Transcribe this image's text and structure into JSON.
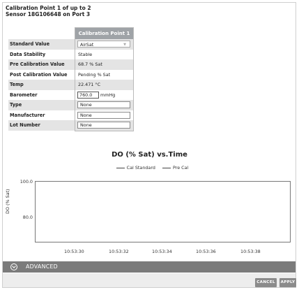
{
  "calibration": {
    "title_line1": "Calibration Point   1   of up to   2",
    "title_line2": "Sensor 18G106648 on Port 3",
    "column_header": "Calibration Point   1"
  },
  "rows": [
    {
      "label": "Standard Value",
      "value": "AirSat"
    },
    {
      "label": "Data Stability",
      "value": "Stable"
    },
    {
      "label": "Pre Calibration Value",
      "value": "68.7 % Sat"
    },
    {
      "label": "Post Calibration Value",
      "value": "Pending % Sat"
    },
    {
      "label": "Temp",
      "value": "22.471 °C"
    },
    {
      "label": "Barometer",
      "value": "760.0",
      "unit": "mmHg"
    },
    {
      "label": "Type",
      "value": "None"
    },
    {
      "label": "Manufacturer",
      "value": "None"
    },
    {
      "label": "Lot Number",
      "value": "None"
    }
  ],
  "chart_data": {
    "type": "line",
    "title": "DO (% Sat) vs.Time",
    "ylabel": "DO (% Sat)",
    "ylim": [
      72,
      100
    ],
    "y_ticks": [
      "100.0",
      "80.0"
    ],
    "x_ticks": [
      "10:53:30",
      "10:53:32",
      "10:53:34",
      "10:53:36",
      "10:53:38"
    ],
    "series": [
      {
        "name": "Cal Standard",
        "values": []
      },
      {
        "name": "Pre Cal",
        "values": []
      }
    ],
    "legend": "top-center",
    "grid": false
  },
  "advanced": {
    "label": "ADVANCED",
    "icon": "chevron-down-circle-icon"
  },
  "buttons": {
    "cancel": "CANCEL",
    "apply": "APPLY"
  }
}
